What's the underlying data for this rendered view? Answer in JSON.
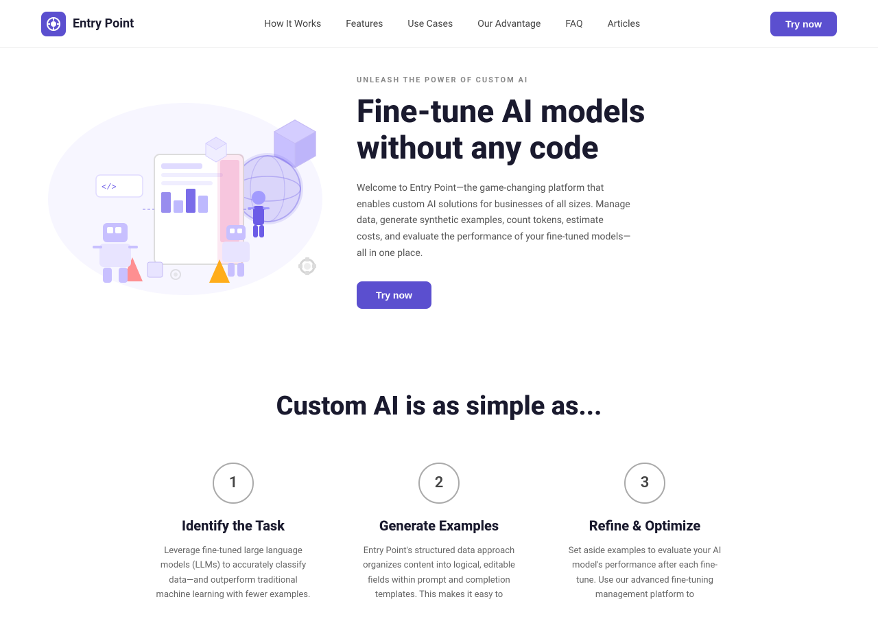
{
  "brand": {
    "logo_text": "Entry Point",
    "logo_symbol": "EP"
  },
  "nav": {
    "links": [
      {
        "label": "How It Works"
      },
      {
        "label": "Features"
      },
      {
        "label": "Use Cases"
      },
      {
        "label": "Our Advantage"
      },
      {
        "label": "FAQ"
      },
      {
        "label": "Articles"
      }
    ],
    "cta_label": "Try now"
  },
  "hero": {
    "eyebrow": "UNLEASH THE POWER OF CUSTOM AI",
    "title_line1": "Fine-tune AI models",
    "title_line2": "without any code",
    "description": "Welcome to Entry Point—the game-changing platform that enables custom AI solutions for businesses of all sizes. Manage data, generate synthetic examples, count tokens, estimate costs, and evaluate the performance of your fine-tuned models—all in one place.",
    "cta_label": "Try now"
  },
  "steps_section": {
    "title": "Custom AI is as simple as...",
    "steps": [
      {
        "number": "1",
        "title": "Identify the Task",
        "description": "Leverage fine-tuned large language models (LLMs) to accurately classify data—and outperform traditional machine learning with fewer examples."
      },
      {
        "number": "2",
        "title": "Generate Examples",
        "description": "Entry Point's structured data approach organizes content into logical, editable fields within prompt and completion templates. This makes it easy to"
      },
      {
        "number": "3",
        "title": "Refine & Optimize",
        "description": "Set aside examples to evaluate your AI model's performance after each fine-tune. Use our advanced fine-tuning management platform to"
      }
    ]
  }
}
